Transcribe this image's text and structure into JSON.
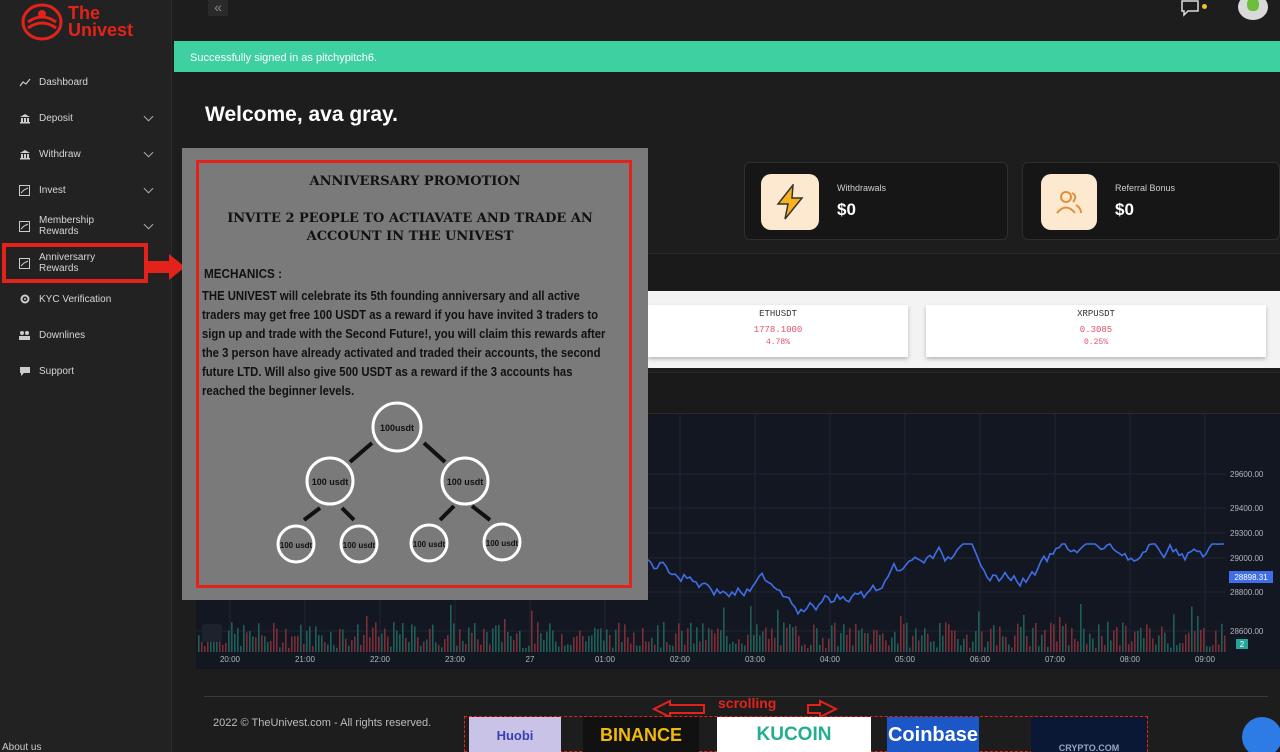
{
  "brand": {
    "line1": "The",
    "line2": "Univest",
    "color": "#e3231b"
  },
  "sidebar": {
    "items": [
      {
        "label": "Dashboard",
        "icon": "chart-line-icon",
        "expandable": false
      },
      {
        "label": "Deposit",
        "icon": "bank-icon",
        "expandable": true
      },
      {
        "label": "Withdraw",
        "icon": "bank-icon",
        "expandable": true
      },
      {
        "label": "Invest",
        "icon": "chart-box-icon",
        "expandable": true
      },
      {
        "label": "Membership Rewards",
        "icon": "chart-box-icon",
        "expandable": true
      },
      {
        "label": "Anniversarry Rewards",
        "icon": "chart-box-icon",
        "expandable": false
      },
      {
        "label": "KYC Verification",
        "icon": "gear-icon",
        "expandable": false
      },
      {
        "label": "Downlines",
        "icon": "users-icon",
        "expandable": false
      },
      {
        "label": "Support",
        "icon": "chat-icon",
        "expandable": false
      }
    ],
    "bottom_text": "About us"
  },
  "topbar": {
    "collapse_glyph": "«"
  },
  "alert": {
    "text": "Successfully signed in as pitchypitch6."
  },
  "welcome": "Welcome, ava gray.",
  "stats": [
    {
      "label": "Withdrawals",
      "value": "$0",
      "icon": "lightning-icon"
    },
    {
      "label": "Referral Bonus",
      "value": "$0",
      "icon": "users-icon"
    }
  ],
  "tickers": [
    {
      "symbol": "ETHUSDT",
      "price": "1778.1000",
      "change": "4.78%"
    },
    {
      "symbol": "XRPUSDT",
      "price": "0.3085",
      "change": "0.25%"
    }
  ],
  "chart_data": {
    "type": "line",
    "price_label": "28898.31",
    "y_ticks": [
      "29600.00",
      "29400.00",
      "29300.00",
      "29000.00",
      "28800.00",
      "28600.00"
    ],
    "x_ticks": [
      "20:00",
      "21:00",
      "22:00",
      "23:00",
      "27",
      "01:00",
      "02:00",
      "03:00",
      "04:00",
      "05:00",
      "06:00",
      "07:00",
      "08:00",
      "09:00"
    ],
    "colors": {
      "line": "#3f6ee8",
      "bg": "#131722"
    }
  },
  "footer": {
    "copyright": "2022 © TheUnivest.com - All rights reserved."
  },
  "partners": {
    "scroll_label": "scrolling",
    "items": [
      "Huobi",
      "BINANCE",
      "KUCOIN",
      "Coinbase",
      "CRYPTO.COM"
    ]
  },
  "promo": {
    "title": "ANNIVERSARY PROMOTION",
    "subtitle": "INVITE 2 PEOPLE TO ACTIAVATE AND TRADE AN ACCOUNT IN THE UNIVEST",
    "mechanics_label": "MECHANICS :",
    "body": "THE UNIVEST will celebrate its 5th founding anniversary and all active traders may get free 100 USDT as a reward if you have invited 3 traders to sign up and trade with the Second Future!, you will claim this rewards after the 3 person have already activated and traded their accounts, the second future LTD. Will also give 500 USDT as a reward if the 3 accounts has reached the beginner levels.",
    "tree": {
      "root": "100usdt",
      "level2": [
        "100 usdt",
        "100 usdt"
      ],
      "level3": [
        "100 usdt",
        "100 usdt",
        "100 usdt",
        "100 usdt"
      ]
    }
  },
  "badge": "2"
}
